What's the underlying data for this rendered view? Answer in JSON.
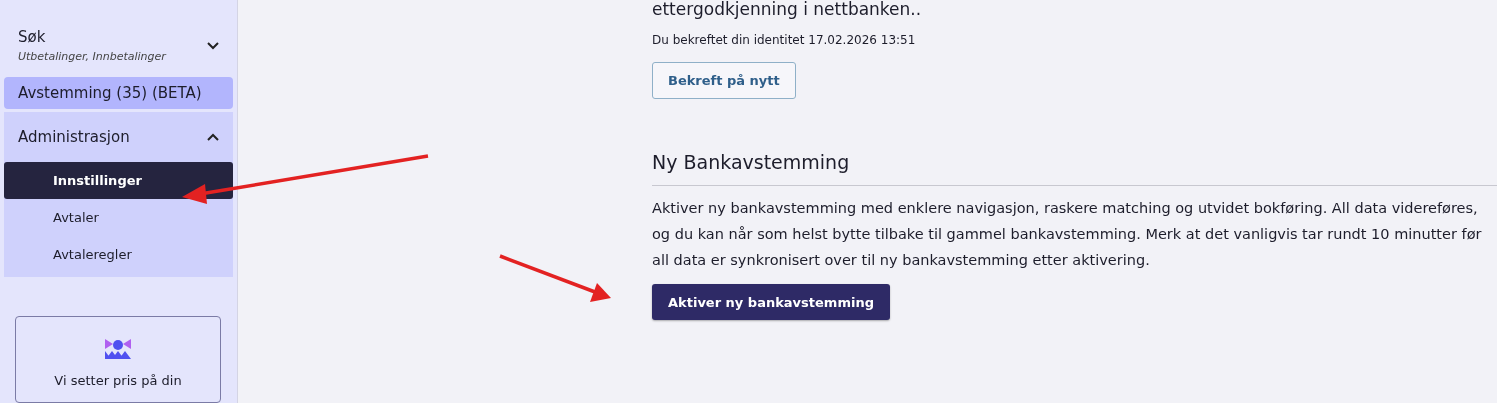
{
  "sidebar": {
    "items": [
      {
        "kind": "search",
        "label": "Søk",
        "subtitle": "Utbetalinger, Innbetalinger",
        "expanded": false
      },
      {
        "kind": "link",
        "label": "Avstemming (35) (BETA)",
        "selected": false
      },
      {
        "kind": "group",
        "label": "Administrasjon",
        "expanded": true,
        "children": [
          {
            "label": "Innstillinger",
            "selected": true
          },
          {
            "label": "Avtaler",
            "selected": false
          },
          {
            "label": "Avtaleregler",
            "selected": false
          }
        ]
      }
    ],
    "feedback": {
      "text": "Vi setter pris på din"
    }
  },
  "main": {
    "intro_tail": "ettergodkjenning i nettbanken..",
    "identity_note": "Du bekreftet din identitet 17.02.2026 13:51",
    "reconfirm_button": "Bekreft på nytt",
    "section": {
      "title": "Ny Bankavstemming",
      "body": "Aktiver ny bankavstemming med enklere navigasjon, raskere matching og utvidet bokføring. All data videreføres, og du kan når som helst bytte tilbake til gammel bankavstemming. Merk at det vanligvis tar rundt 10 minutter før all data er synkronisert over til ny bankavstemming etter aktivering.",
      "activate_button": "Aktiver ny bankavstemming"
    }
  }
}
